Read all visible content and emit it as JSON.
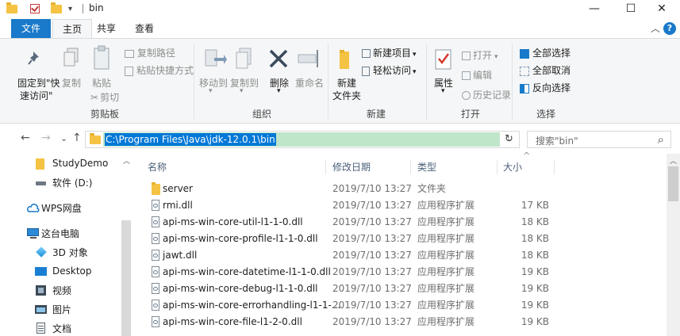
{
  "window": {
    "title": "bin",
    "quick_access_arrow": "▾",
    "minimize": "—",
    "maximize": "☐",
    "close": "✕"
  },
  "tabs": {
    "file": "文件",
    "home": "主页",
    "share": "共享",
    "view": "查看",
    "collapse": "︿",
    "help": "?"
  },
  "ribbon": {
    "clipboard": {
      "pin": "固定到\"快",
      "pin2": "速访问\"",
      "copy": "复制",
      "paste": "粘贴",
      "copy_path": "复制路径",
      "paste_shortcut": "粘贴快捷方式",
      "cut": "剪切",
      "label": "剪贴板"
    },
    "organize": {
      "move_to": "移动到",
      "copy_to": "复制到",
      "delete": "删除",
      "rename": "重命名",
      "label": "组织"
    },
    "new": {
      "new_item": "新建项目",
      "easy_access": "轻松访问",
      "new_folder": "新建",
      "new_folder2": "文件夹",
      "label": "新建"
    },
    "open": {
      "properties": "属性",
      "open": "打开",
      "edit": "编辑",
      "history": "历史记录",
      "label": "打开"
    },
    "select": {
      "select_all": "全部选择",
      "select_none": "全部取消",
      "invert": "反向选择",
      "label": "选择"
    }
  },
  "nav": {
    "back": "←",
    "forward": "→",
    "recent": "⌄",
    "up": "↑",
    "address": "C:\\Program Files\\Java\\jdk-12.0.1\\bin",
    "dropdown": "⌄",
    "refresh": "↻",
    "search_placeholder": "搜索\"bin\"",
    "search_icon": "⌕"
  },
  "sidebar": [
    {
      "label": "StudyDemo",
      "icon": "folder-icon"
    },
    {
      "label": "软件 (D:)",
      "icon": "drive-icon"
    },
    {
      "label": "WPS网盘",
      "icon": "cloud-icon"
    },
    {
      "label": "这台电脑",
      "icon": "computer-icon"
    },
    {
      "label": "3D 对象",
      "icon": "cube-icon"
    },
    {
      "label": "Desktop",
      "icon": "desktop-icon"
    },
    {
      "label": "视频",
      "icon": "video-icon"
    },
    {
      "label": "图片",
      "icon": "picture-icon"
    },
    {
      "label": "文档",
      "icon": "document-icon"
    }
  ],
  "columns": {
    "name": "名称",
    "date": "修改日期",
    "type": "类型",
    "size": "大小",
    "sort_caret": "^"
  },
  "files": [
    {
      "name": "server",
      "date": "2019/7/10 13:27",
      "type": "文件夹",
      "size": "",
      "kind": "folder"
    },
    {
      "name": "rmi.dll",
      "date": "2019/7/10 13:27",
      "type": "应用程序扩展",
      "size": "17 KB",
      "kind": "dll"
    },
    {
      "name": "api-ms-win-core-util-l1-1-0.dll",
      "date": "2019/7/10 13:27",
      "type": "应用程序扩展",
      "size": "18 KB",
      "kind": "dll"
    },
    {
      "name": "api-ms-win-core-profile-l1-1-0.dll",
      "date": "2019/7/10 13:27",
      "type": "应用程序扩展",
      "size": "18 KB",
      "kind": "dll"
    },
    {
      "name": "jawt.dll",
      "date": "2019/7/10 13:27",
      "type": "应用程序扩展",
      "size": "18 KB",
      "kind": "dll"
    },
    {
      "name": "api-ms-win-core-datetime-l1-1-0.dll",
      "date": "2019/7/10 13:27",
      "type": "应用程序扩展",
      "size": "19 KB",
      "kind": "dll"
    },
    {
      "name": "api-ms-win-core-debug-l1-1-0.dll",
      "date": "2019/7/10 13:27",
      "type": "应用程序扩展",
      "size": "19 KB",
      "kind": "dll"
    },
    {
      "name": "api-ms-win-core-errorhandling-l1-1-...",
      "date": "2019/7/10 13:27",
      "type": "应用程序扩展",
      "size": "19 KB",
      "kind": "dll"
    },
    {
      "name": "api-ms-win-core-file-l1-2-0.dll",
      "date": "2019/7/10 13:27",
      "type": "应用程序扩展",
      "size": "19 KB",
      "kind": "dll"
    }
  ],
  "colors": {
    "accent": "#1979ca",
    "selection": "#0078d7",
    "address_highlight": "#bfe6c9",
    "folder": "#f5c343"
  }
}
